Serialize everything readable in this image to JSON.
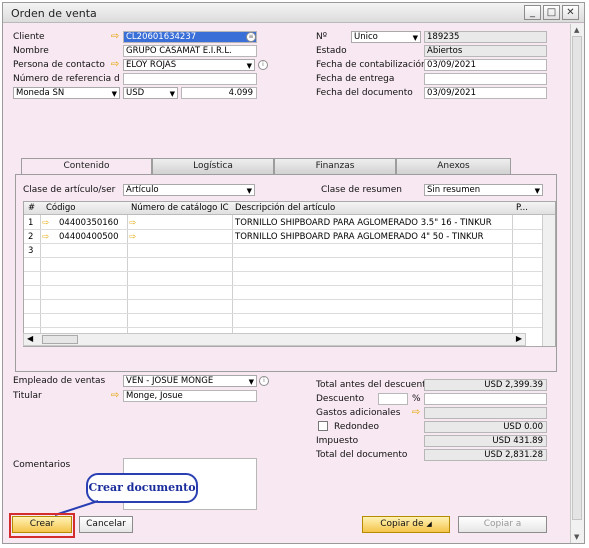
{
  "window": {
    "title": "Orden de venta",
    "min": "_",
    "max": "□",
    "close": "✕"
  },
  "header": {
    "cliente_label": "Cliente",
    "cliente": "CL20601634237",
    "nombre_label": "Nombre",
    "nombre": "GRUPO CASAMAT E.I.R.L.",
    "contacto_label": "Persona de contacto",
    "contacto": "ELOY ROJAS",
    "ref_label": "Número de referencia d",
    "ref": "",
    "moneda_sn": "Moneda SN",
    "moneda": "USD",
    "tipo_cambio": "4.099",
    "no_label": "Nº",
    "serie": "Unico",
    "numero": "189235",
    "estado_label": "Estado",
    "estado": "Abiertos",
    "fcontab_label": "Fecha de contabilización",
    "fcontab": "03/09/2021",
    "fentrega_label": "Fecha de entrega",
    "fentrega": "",
    "fdoc_label": "Fecha del documento",
    "fdoc": "03/09/2021"
  },
  "tabs": [
    "Contenido",
    "Logística",
    "Finanzas",
    "Anexos"
  ],
  "content": {
    "clase_label": "Clase de artículo/ser",
    "clase": "Artículo",
    "resumen_label": "Clase de resumen",
    "resumen": "Sin resumen",
    "columns": [
      "#",
      "Código",
      "Número de catálogo IC",
      "Descripción del artículo",
      "P..."
    ],
    "rows": [
      {
        "n": "1",
        "codigo": "04400350160",
        "desc": "TORNILLO SHIPBOARD PARA AGLOMERADO 3.5\" 16 - TINKUR"
      },
      {
        "n": "2",
        "codigo": "04400400500",
        "desc": "TORNILLO SHIPBOARD PARA AGLOMERADO 4\" 50 - TINKUR"
      },
      {
        "n": "3",
        "codigo": "",
        "desc": ""
      }
    ]
  },
  "footer": {
    "empleado_label": "Empleado de ventas",
    "empleado": "VEN - JOSUE MONGE",
    "titular_label": "Titular",
    "titular": "Monge, Josue",
    "comentarios_label": "Comentarios",
    "total_antes_label": "Total antes del descuento",
    "total_antes": "USD 2,399.39",
    "descuento_label": "Descuento",
    "pct": "%",
    "gastos_label": "Gastos adicionales",
    "redondeo_label": "Redondeo",
    "redondeo": "USD 0.00",
    "impuesto_label": "Impuesto",
    "impuesto": "USD 431.89",
    "total_label": "Total del documento",
    "total": "USD 2,831.28"
  },
  "buttons": {
    "crear": "Crear",
    "cancelar": "Cancelar",
    "copiar_de": "Copiar de",
    "copiar_a": "Copiar a"
  },
  "callout": "Crear documento"
}
